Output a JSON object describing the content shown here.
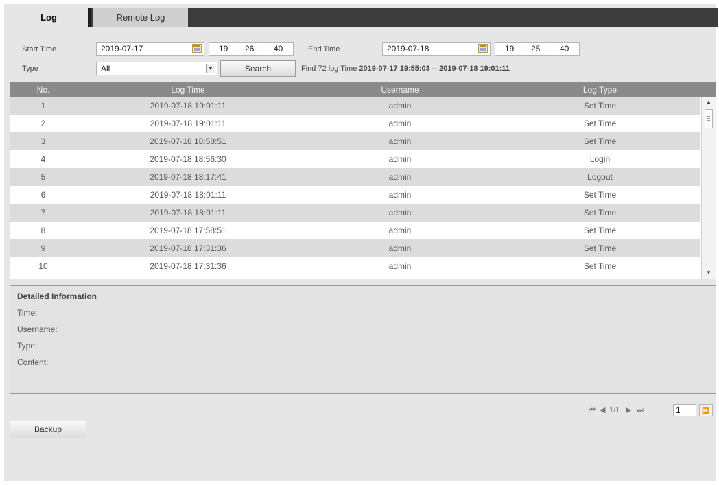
{
  "tabs": [
    {
      "label": "Log",
      "active": true
    },
    {
      "label": "Remote Log",
      "active": false
    }
  ],
  "filters": {
    "start_time_label": "Start Time",
    "start_date": "2019-07-17",
    "start_hh": "19",
    "start_mm": "26",
    "start_ss": "40",
    "end_time_label": "End Time",
    "end_date": "2019-07-18",
    "end_hh": "19",
    "end_mm": "25",
    "end_ss": "40",
    "time_sep": ":",
    "type_label": "Type",
    "type_value": "All",
    "search_label": "Search",
    "find_prefix": "Find 72 log Time",
    "find_range": "2019-07-17 19:55:03 -- 2019-07-18 19:01:11"
  },
  "table": {
    "headers": [
      "No.",
      "Log Time",
      "Username",
      "Log Type"
    ],
    "rows": [
      {
        "no": "1",
        "time": "2019-07-18 19:01:11",
        "user": "admin",
        "type": "Set Time"
      },
      {
        "no": "2",
        "time": "2019-07-18 19:01:11",
        "user": "admin",
        "type": "Set Time"
      },
      {
        "no": "3",
        "time": "2019-07-18 18:58:51",
        "user": "admin",
        "type": "Set Time"
      },
      {
        "no": "4",
        "time": "2019-07-18 18:56:30",
        "user": "admin",
        "type": "Login"
      },
      {
        "no": "5",
        "time": "2019-07-18 18:17:41",
        "user": "admin",
        "type": "Logout"
      },
      {
        "no": "6",
        "time": "2019-07-18 18:01:11",
        "user": "admin",
        "type": "Set Time"
      },
      {
        "no": "7",
        "time": "2019-07-18 18:01:11",
        "user": "admin",
        "type": "Set Time"
      },
      {
        "no": "8",
        "time": "2019-07-18 17:58:51",
        "user": "admin",
        "type": "Set Time"
      },
      {
        "no": "9",
        "time": "2019-07-18 17:31:36",
        "user": "admin",
        "type": "Set Time"
      },
      {
        "no": "10",
        "time": "2019-07-18 17:31:36",
        "user": "admin",
        "type": "Set Time"
      }
    ]
  },
  "details": {
    "title": "Detailed Information",
    "time_label": "Time:",
    "username_label": "Username:",
    "type_label": "Type:",
    "content_label": "Content:"
  },
  "pager": {
    "first": "⏮",
    "prev": "◀",
    "page_info": "1/1",
    "next": "▶",
    "last": "⏭",
    "page_value": "1",
    "go": "⏩"
  },
  "backup_label": "Backup",
  "icons": {
    "calendar": "calendar-icon",
    "dropdown": "chevron-down-icon",
    "scroll_up": "scroll-up-icon",
    "scroll_down": "scroll-down-icon"
  },
  "colors": {
    "tab_bar": "#3c3c3c",
    "header": "#8a8a8a",
    "row_alt": "#dcdcdc",
    "panel": "#e6e6e6"
  }
}
